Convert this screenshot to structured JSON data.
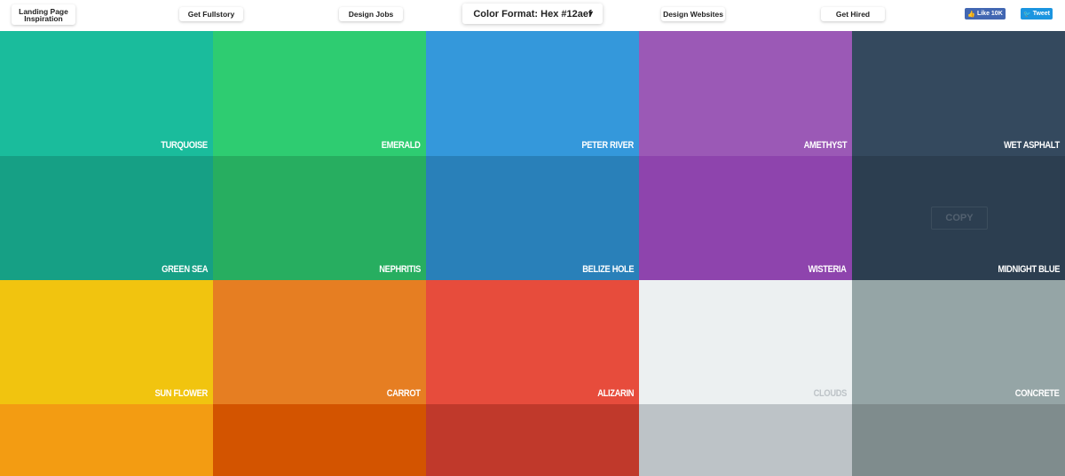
{
  "header": {
    "nav": [
      {
        "label": "Landing Page Inspiration"
      },
      {
        "label": "Get Fullstory"
      },
      {
        "label": "Design Jobs"
      },
      {
        "label": "Design Websites"
      },
      {
        "label": "Get Hired"
      }
    ],
    "color_format": {
      "label": "Color Format: Hex #12aef",
      "caret": "▼"
    },
    "social": {
      "like_label": "Like 10K",
      "tweet_label": "Tweet",
      "facebook_color": "#4267b2",
      "twitter_color": "#1b95e0"
    }
  },
  "swatches": [
    {
      "name": "TURQUOISE",
      "hex": "#1abc9c"
    },
    {
      "name": "EMERALD",
      "hex": "#2ecc71"
    },
    {
      "name": "PETER RIVER",
      "hex": "#3498db"
    },
    {
      "name": "AMETHYST",
      "hex": "#9b59b6"
    },
    {
      "name": "WET ASPHALT",
      "hex": "#34495e"
    },
    {
      "name": "GREEN SEA",
      "hex": "#16a085"
    },
    {
      "name": "NEPHRITIS",
      "hex": "#27ae60"
    },
    {
      "name": "BELIZE HOLE",
      "hex": "#2980b9"
    },
    {
      "name": "WISTERIA",
      "hex": "#8e44ad"
    },
    {
      "name": "MIDNIGHT BLUE",
      "hex": "#2c3e50",
      "copy_label": "COPY"
    },
    {
      "name": "SUN FLOWER",
      "hex": "#f1c40f"
    },
    {
      "name": "CARROT",
      "hex": "#e67e22"
    },
    {
      "name": "ALIZARIN",
      "hex": "#e74c3c"
    },
    {
      "name": "CLOUDS",
      "hex": "#ecf0f1",
      "light": true
    },
    {
      "name": "CONCRETE",
      "hex": "#95a5a6"
    },
    {
      "name": "",
      "hex": "#f39c12"
    },
    {
      "name": "",
      "hex": "#d35400"
    },
    {
      "name": "",
      "hex": "#c0392b"
    },
    {
      "name": "",
      "hex": "#bdc3c7"
    },
    {
      "name": "",
      "hex": "#7f8c8d"
    }
  ]
}
